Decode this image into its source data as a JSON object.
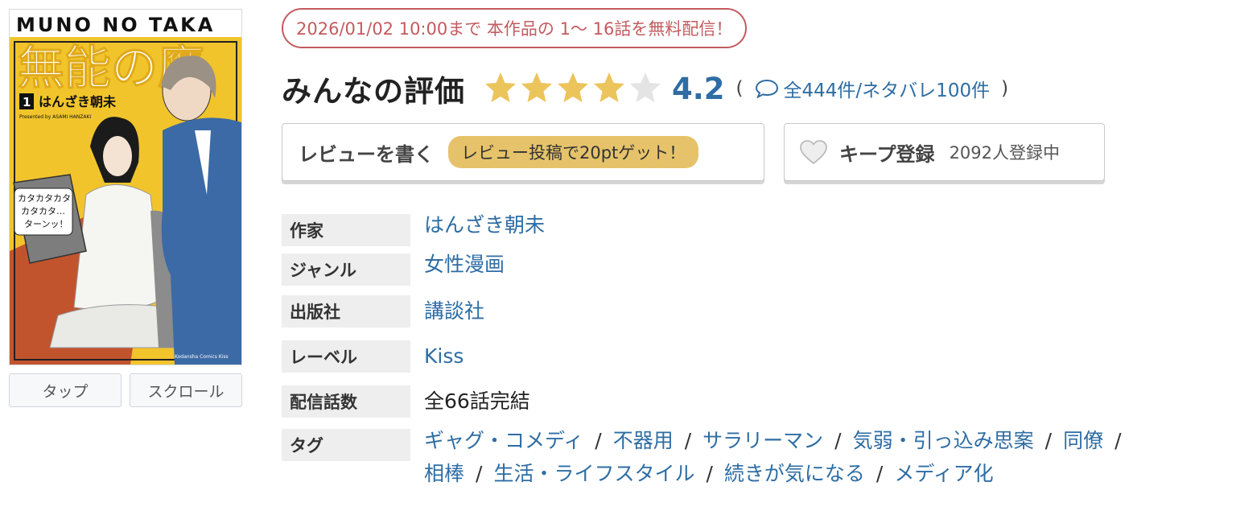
{
  "cover": {
    "title_en": "MUNO NO TAKA",
    "title_jp": "無能の鷹",
    "volume": "1",
    "author": "はんざき朝未",
    "presented_by": "Presented by ASAMI HANZAKI",
    "bubble_line1": "カタカタカタ",
    "bubble_line2": "カタカタ…",
    "bubble_line3": "ターンッ！",
    "imprint": "Kodansha Comics Kiss",
    "colors": {
      "yellow": "#f1c42c",
      "orange": "#c2542d",
      "blue": "#3c6aa6"
    }
  },
  "view_buttons": {
    "tap": "タップ",
    "scroll": "スクロール"
  },
  "campaign": {
    "text": "2026/01/02 10:00まで 本作品の 1〜 16話を無料配信！",
    "color": "#c35b5f"
  },
  "rating": {
    "title": "みんなの評価",
    "score": "4.2",
    "stars_value": 4.2,
    "stars_max": 5,
    "open_paren": "(",
    "close_paren": ")",
    "reviews_label": "全444件/ネタバレ100件",
    "star_color": "#ecc45c",
    "link_color": "#2e6da4"
  },
  "review_button": {
    "label": "レビューを書く",
    "promo": "レビュー投稿で20ptゲット！"
  },
  "keep_button": {
    "label": "キープ登録",
    "count": "2092人登録中"
  },
  "info": {
    "author": {
      "label": "作家",
      "value": "はんざき朝未"
    },
    "genre": {
      "label": "ジャンル",
      "value": "女性漫画"
    },
    "publisher": {
      "label": "出版社",
      "value": "講談社"
    },
    "label": {
      "label": "レーベル",
      "value": "Kiss"
    },
    "episodes": {
      "label": "配信話数",
      "value": "全66話完結"
    },
    "tags": {
      "label": "タグ",
      "separator": "/",
      "items": [
        "ギャグ・コメディ",
        "不器用",
        "サラリーマン",
        "気弱・引っ込み思案",
        "同僚",
        "相棒",
        "生活・ライフスタイル",
        "続きが気になる",
        "メディア化"
      ]
    }
  }
}
